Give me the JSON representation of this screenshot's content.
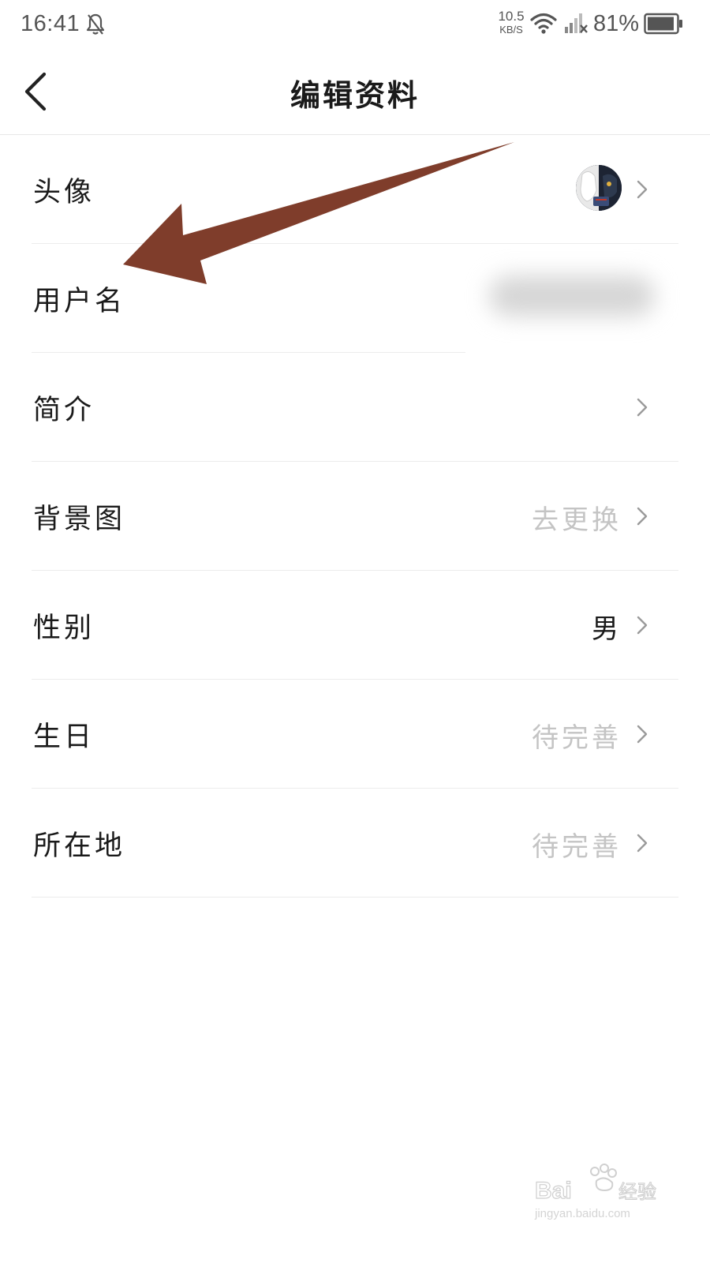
{
  "status_bar": {
    "time": "16:41",
    "net_speed": "10.5",
    "net_speed_unit": "KB/S",
    "battery_percent": "81%",
    "icons": [
      "bell-off-icon",
      "wifi-icon",
      "cellular-signal-icon",
      "battery-icon"
    ]
  },
  "header": {
    "title": "编辑资料",
    "back_icon": "chevron-left-icon"
  },
  "rows": [
    {
      "label": "头像",
      "type": "avatar"
    },
    {
      "label": "用户名",
      "value": ""
    },
    {
      "label": "简介",
      "value": ""
    },
    {
      "label": "背景图",
      "value": "去更换"
    },
    {
      "label": "性别",
      "value": "男"
    },
    {
      "label": "生日",
      "value": "待完善"
    },
    {
      "label": "所在地",
      "value": "待完善"
    }
  ],
  "annotation": {
    "shape": "arrow",
    "color": "#7f3d2b",
    "points_to": "用户名"
  },
  "watermark": {
    "brand": "Bai经验",
    "url": "jingyan.baidu.com"
  },
  "colors": {
    "text_primary": "#1a1a1a",
    "text_placeholder": "#c4c4c4",
    "divider": "#ececec",
    "status_text": "#555555"
  }
}
